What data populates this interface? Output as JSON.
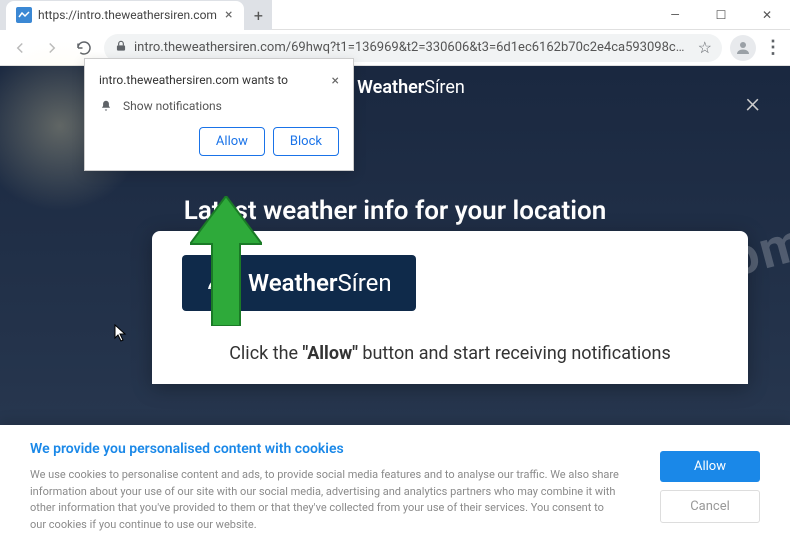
{
  "window": {
    "tab_title": "https://intro.theweathersiren.com",
    "url": "intro.theweathersiren.com/69hwq?t1=136969&t2=330606&t3=6d1ec6162b70c2e4ca593098c1642e381cff4e93d5decef9d3a..."
  },
  "permission": {
    "title": "intro.theweathersiren.com wants to",
    "row": "Show notifications",
    "allow": "Allow",
    "block": "Block"
  },
  "site": {
    "brand_light": "Weather",
    "brand_bold": "Síren",
    "headline": "Latest weather info for your location",
    "instruction_pre": "Click the ",
    "instruction_bold": "\"Allow\"",
    "instruction_post": " button and start receiving notifications"
  },
  "cookies": {
    "title": "We provide you personalised content with cookies",
    "body": "We use cookies to personalise content and ads, to provide social media features and to analyse our traffic. We also share information about your use of our site with our social media, advertising and analytics partners who may combine it with other information that you've provided to them or that they've collected from your use of their services. You consent to our cookies if you continue to use our website.",
    "allow": "Allow",
    "cancel": "Cancel"
  },
  "watermark": "pcrisk.com"
}
